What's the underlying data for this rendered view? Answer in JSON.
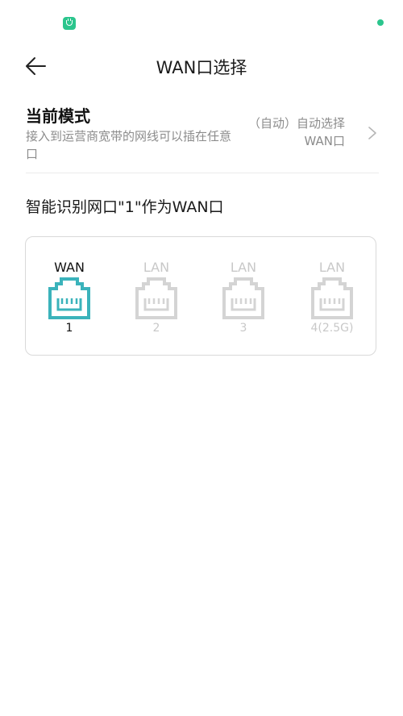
{
  "status_bar": {
    "app_icon": "mi-home-icon",
    "indicator": "green-dot",
    "accent_color": "#2bc58d"
  },
  "header": {
    "title": "WAN口选择",
    "back_icon": "back-arrow-icon"
  },
  "mode": {
    "title": "当前模式",
    "description": "接入到运营商宽带的网线可以插在任意口",
    "value": "（自动）自动选择WAN口",
    "chevron_icon": "chevron-right-icon"
  },
  "detect_text": "智能识别网口\"1\"作为WAN口",
  "ports": [
    {
      "type": "WAN",
      "number": "1",
      "active": true,
      "color": "#3bb3bb"
    },
    {
      "type": "LAN",
      "number": "2",
      "active": false,
      "color": "#d4d4d4"
    },
    {
      "type": "LAN",
      "number": "3",
      "active": false,
      "color": "#d4d4d4"
    },
    {
      "type": "LAN",
      "number": "4(2.5G)",
      "active": false,
      "color": "#d4d4d4"
    }
  ]
}
